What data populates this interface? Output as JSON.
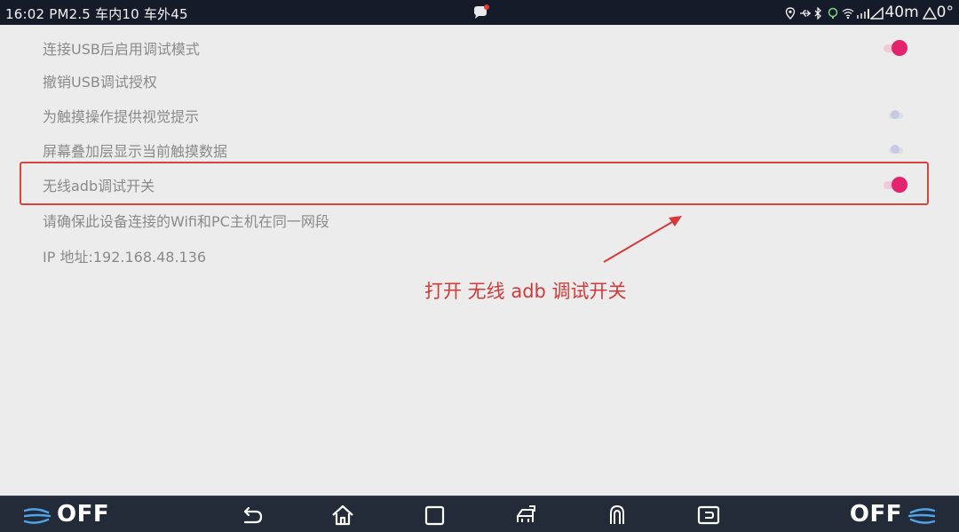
{
  "status_bar": {
    "left_text": "16:02 PM2.5 车内10 车外45",
    "distance": "40m",
    "temperature": "0°"
  },
  "settings": {
    "items": [
      {
        "label": "连接USB后启用调试模式",
        "toggle": "on"
      },
      {
        "label": "撤销USB调试授权"
      },
      {
        "label": "为触摸操作提供视觉提示",
        "toggle": "off"
      },
      {
        "label": "屏幕叠加层显示当前触摸数据",
        "toggle": "off"
      },
      {
        "label": "无线adb调试开关",
        "toggle": "on"
      },
      {
        "label": "请确保此设备连接的Wifi和PC主机在同一网段"
      },
      {
        "label": "IP 地址:192.168.48.136"
      }
    ]
  },
  "annotation": {
    "text": "打开 无线 adb 调试开关",
    "color": "#d33a3a"
  },
  "nav_bar": {
    "climate_left_label": "OFF",
    "climate_right_label": "OFF",
    "buttons": [
      "back-icon",
      "home-icon",
      "recents-icon",
      "car-icon",
      "u-turn-icon",
      "media-icon"
    ]
  },
  "colors": {
    "accent": "#e1246d",
    "status_bar_bg": "#161b2a",
    "nav_bar_bg": "#232a38",
    "page_bg": "#ececec"
  }
}
